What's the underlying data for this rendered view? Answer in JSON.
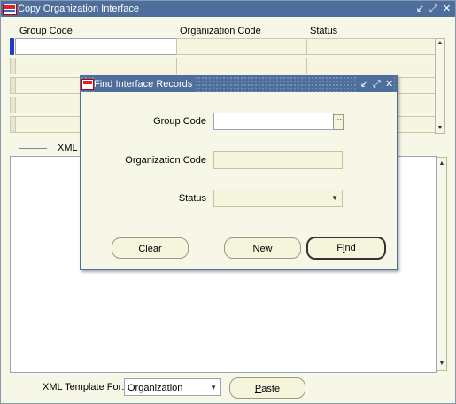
{
  "window": {
    "title": "Copy Organization Interface",
    "controls": [
      "↙",
      "⤢",
      "✕"
    ]
  },
  "grid": {
    "headers": [
      "Group Code",
      "Organization Code",
      "Status"
    ]
  },
  "xml_section": {
    "label": "XML"
  },
  "footer": {
    "template_label": "XML Template For:",
    "template_value": "Organization",
    "paste_label": "Paste",
    "paste_mnemonic": "P",
    "paste_rest": "aste"
  },
  "dialog": {
    "title": "Find Interface Records",
    "controls": [
      "↙",
      "⤢",
      "✕"
    ],
    "fields": {
      "group_code_label": "Group Code",
      "org_code_label": "Organization Code",
      "status_label": "Status"
    },
    "buttons": {
      "clear_mnemonic": "C",
      "clear_rest": "lear",
      "new_mnemonic": "N",
      "new_rest": "ew",
      "find_pre": "F",
      "find_mnemonic": "i",
      "find_rest": "nd"
    }
  },
  "icons": {
    "lov": "ellipsis-icon",
    "dropdown": "triangle-down-icon",
    "scroll_up": "triangle-up-icon",
    "scroll_down": "triangle-down-icon"
  },
  "colors": {
    "titlebar": "#4e6f9b",
    "canvas": "#f7f7e7",
    "field_readonly": "#f5f5dc",
    "current_record": "#1f3cc8"
  }
}
